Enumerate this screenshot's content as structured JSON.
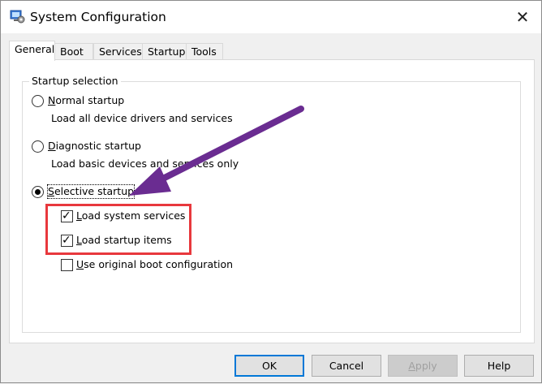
{
  "window": {
    "title": "System Configuration",
    "close_glyph": "✕"
  },
  "tabs": [
    {
      "label": "General",
      "active": true
    },
    {
      "label": "Boot",
      "active": false
    },
    {
      "label": "Services",
      "active": false
    },
    {
      "label": "Startup",
      "active": false
    },
    {
      "label": "Tools",
      "active": false
    }
  ],
  "startup_selection": {
    "group_label": "Startup selection",
    "options": [
      {
        "mnemonic": "N",
        "rest": "ormal startup",
        "description": "Load all device drivers and services",
        "selected": false
      },
      {
        "mnemonic": "D",
        "rest": "iagnostic startup",
        "description": "Load basic devices and services only",
        "selected": false
      },
      {
        "mnemonic": "S",
        "rest": "elective startup",
        "description": "",
        "selected": true
      }
    ],
    "checkboxes": [
      {
        "mnemonic": "L",
        "rest": "oad system services",
        "checked": true
      },
      {
        "mnemonic": "L",
        "rest": "oad startup items",
        "checked": true
      },
      {
        "mnemonic": "U",
        "rest": "se original boot configuration",
        "checked": false
      }
    ]
  },
  "buttons": {
    "ok": "OK",
    "cancel": "Cancel",
    "apply_mnemonic": "A",
    "apply_rest": "pply",
    "help": "Help"
  },
  "annotations": {
    "arrow_color": "#6a2c91",
    "highlight_color": "#e8383d"
  },
  "colors": {
    "default_button_border": "#0078d7"
  }
}
